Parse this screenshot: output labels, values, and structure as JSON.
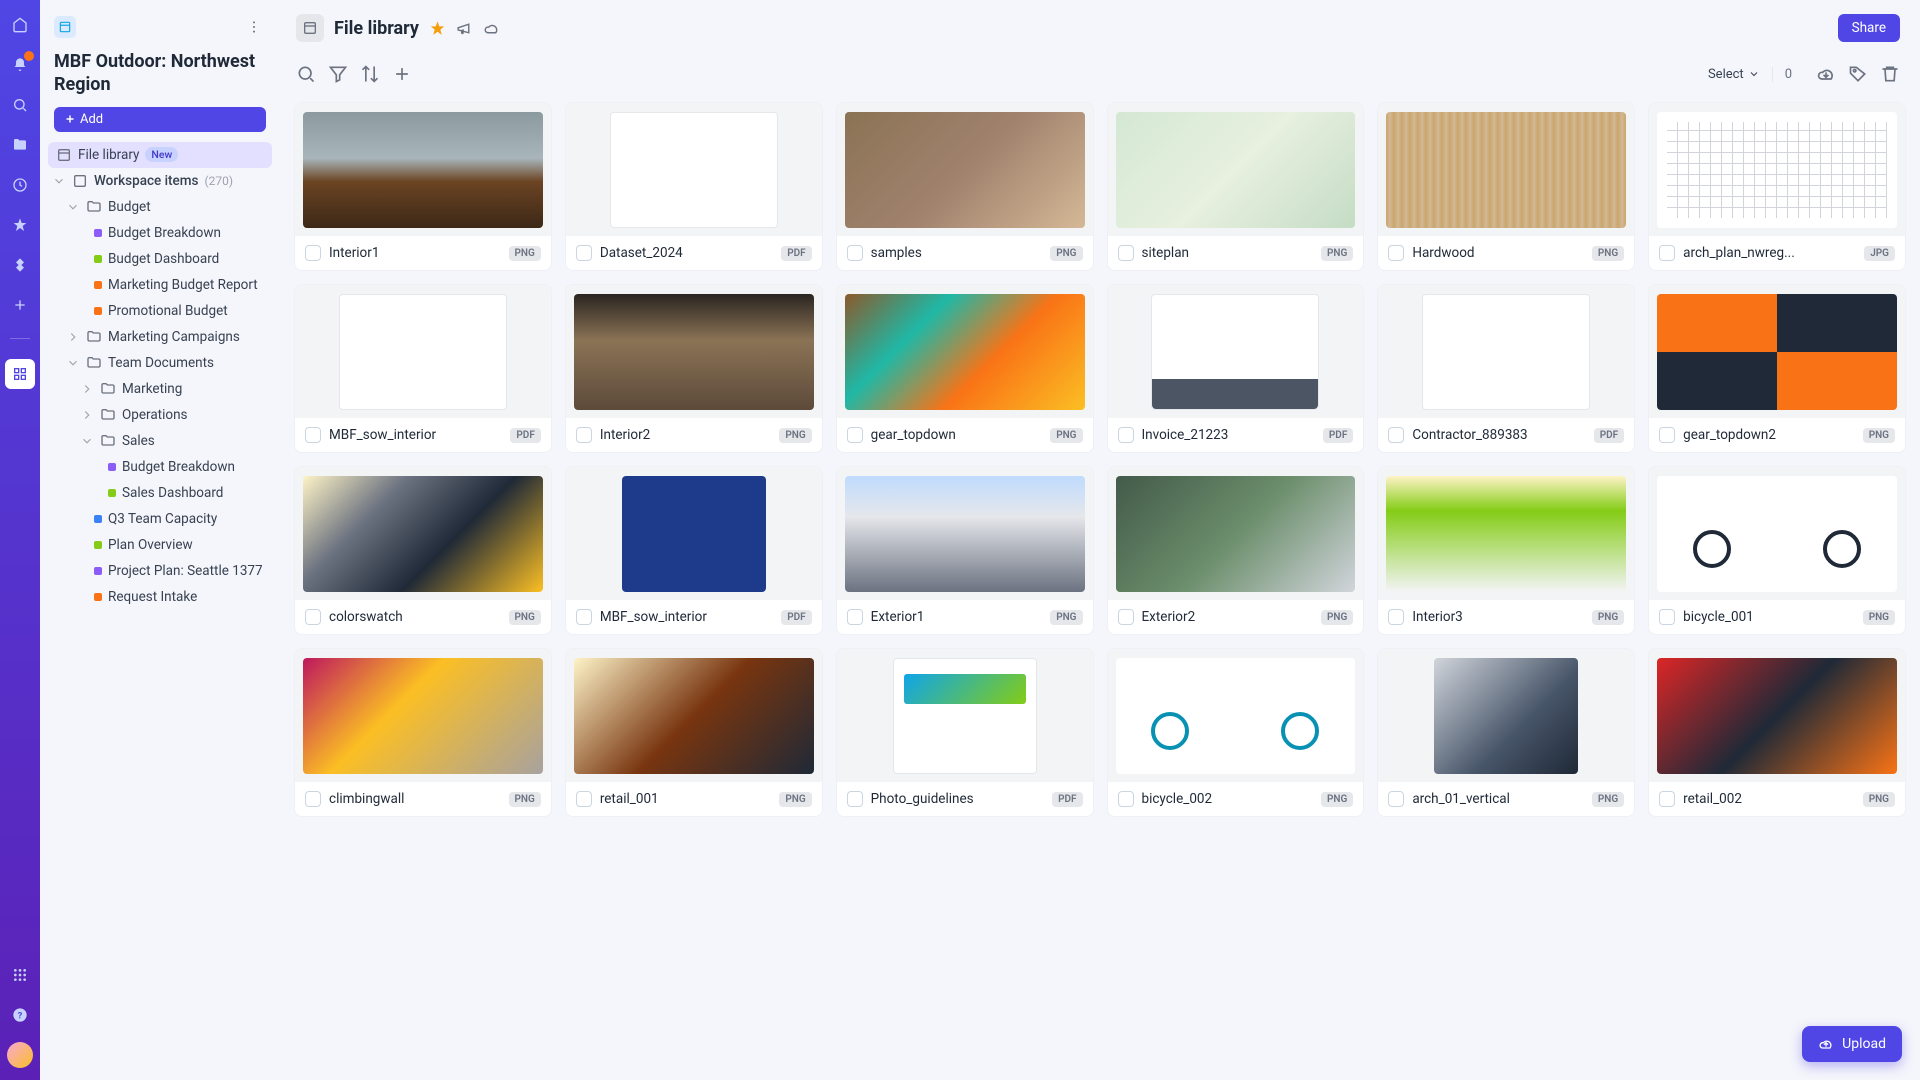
{
  "workspace": {
    "title": "MBF Outdoor: Northwest Region"
  },
  "add_button": "Add",
  "sidebar": {
    "file_library": "File library",
    "new_tag": "New",
    "workspace_items": "Workspace items",
    "count": "(270)",
    "items": {
      "budget": "Budget",
      "budget_breakdown": "Budget Breakdown",
      "budget_dashboard": "Budget Dashboard",
      "marketing_budget_report": "Marketing Budget Report",
      "promotional_budget": "Promotional Budget",
      "marketing_campaigns": "Marketing Campaigns",
      "team_documents": "Team Documents",
      "marketing": "Marketing",
      "operations": "Operations",
      "sales": "Sales",
      "mbf_budget_breakdown": "Budget Breakdown",
      "sales_dashboard": "Sales Dashboard",
      "q3_team_capacity": "Q3 Team Capacity",
      "plan_overview": "Plan Overview",
      "project_plan_seattle": "Project Plan: Seattle 1377",
      "request_intake": "Request Intake"
    }
  },
  "topbar": {
    "title": "File library",
    "share": "Share"
  },
  "toolbar": {
    "select": "Select",
    "count": "0"
  },
  "upload_button": "Upload",
  "colors": {
    "purple": "#8b5cf6",
    "green": "#84cc16",
    "orange": "#f97316",
    "blue": "#3b82f6"
  },
  "files": [
    {
      "name": "Interior1",
      "type": "PNG",
      "thumb": "ph-interior"
    },
    {
      "name": "Dataset_2024",
      "type": "PDF",
      "thumb": "ph-doc"
    },
    {
      "name": "samples",
      "type": "PNG",
      "thumb": "ph-samples"
    },
    {
      "name": "siteplan",
      "type": "PNG",
      "thumb": "ph-siteplan"
    },
    {
      "name": "Hardwood",
      "type": "PNG",
      "thumb": "ph-wood"
    },
    {
      "name": "arch_plan_nwreg...",
      "type": "JPG",
      "thumb": "ph-arch"
    },
    {
      "name": "MBF_sow_interior",
      "type": "PDF",
      "thumb": "ph-doc"
    },
    {
      "name": "Interior2",
      "type": "PNG",
      "thumb": "ph-wall"
    },
    {
      "name": "gear_topdown",
      "type": "PNG",
      "thumb": "ph-gear"
    },
    {
      "name": "Invoice_21223",
      "type": "PDF",
      "thumb": "ph-invoice"
    },
    {
      "name": "Contractor_889383",
      "type": "PDF",
      "thumb": "ph-doc"
    },
    {
      "name": "gear_topdown2",
      "type": "PNG",
      "thumb": "ph-gear2"
    },
    {
      "name": "colorswatch",
      "type": "PNG",
      "thumb": "ph-swatch"
    },
    {
      "name": "MBF_sow_interior",
      "type": "PDF",
      "thumb": "ph-blue"
    },
    {
      "name": "Exterior1",
      "type": "PNG",
      "thumb": "ph-ext"
    },
    {
      "name": "Exterior2",
      "type": "PNG",
      "thumb": "ph-aerial"
    },
    {
      "name": "Interior3",
      "type": "PNG",
      "thumb": "ph-int3"
    },
    {
      "name": "bicycle_001",
      "type": "PNG",
      "thumb": "ph-bike"
    },
    {
      "name": "climbingwall",
      "type": "PNG",
      "thumb": "ph-climb"
    },
    {
      "name": "retail_001",
      "type": "PNG",
      "thumb": "ph-retail"
    },
    {
      "name": "Photo_guidelines",
      "type": "PDF",
      "thumb": "ph-photo"
    },
    {
      "name": "bicycle_002",
      "type": "PNG",
      "thumb": "ph-bike2"
    },
    {
      "name": "arch_01_vertical",
      "type": "PNG",
      "thumb": "ph-archv"
    },
    {
      "name": "retail_002",
      "type": "PNG",
      "thumb": "ph-retail2"
    }
  ]
}
